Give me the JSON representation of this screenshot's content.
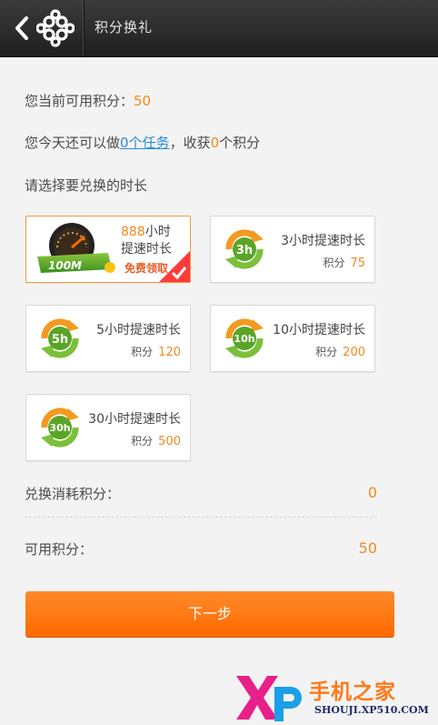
{
  "header": {
    "title": "积分换礼"
  },
  "points_line": {
    "label": "您当前可用积分：",
    "value": "50"
  },
  "task_line": {
    "prefix": "您今天还可以做",
    "link": "0个任务",
    "middle": "，收获",
    "count": "0",
    "suffix": "个积分"
  },
  "choose_prompt": "请选择要兑换的时长",
  "packages": [
    {
      "icon": "speedometer-100m-icon",
      "num": "888",
      "title_a": "小时",
      "title_b": "提速时长",
      "free_label": "免费领取",
      "selected": true
    },
    {
      "icon": "3h-badge-icon",
      "title": "3小时提速时长",
      "points_label": "积分",
      "points": "75"
    },
    {
      "icon": "5h-badge-icon",
      "title": "5小时提速时长",
      "points_label": "积分",
      "points": "120"
    },
    {
      "icon": "10h-badge-icon",
      "title": "10小时提速时长",
      "points_label": "积分",
      "points": "200"
    },
    {
      "icon": "30h-badge-icon",
      "title": "30小时提速时长",
      "points_label": "积分",
      "points": "500"
    }
  ],
  "badges": {
    "b3": "3h",
    "b5": "5h",
    "b10": "10h",
    "b30": "30h",
    "speed": "100M"
  },
  "summary": {
    "consume_label": "兑换消耗积分：",
    "consume_value": "0",
    "available_label": "可用积分：",
    "available_value": "50"
  },
  "next_button": "下一步",
  "watermark": {
    "text": "手机之家",
    "url": "SHOUJI.XP510.COM"
  },
  "colors": {
    "accent": "#f08a1d",
    "button": "#ff6f00",
    "link": "#2b8cd8",
    "header": "#2a2a2a"
  }
}
